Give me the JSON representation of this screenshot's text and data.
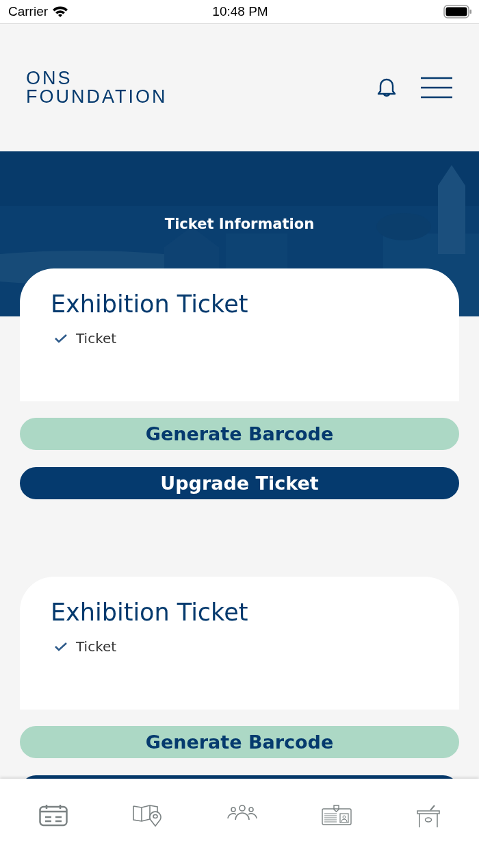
{
  "status_bar": {
    "carrier": "Carrier",
    "time": "10:48 PM"
  },
  "header": {
    "logo_line_1": "ONS",
    "logo_line_2": "FOUNDATION"
  },
  "banner": {
    "title": "Ticket Information"
  },
  "tickets": [
    {
      "title": "Exhibition Ticket",
      "features": [
        "Ticket"
      ],
      "buttons": [
        {
          "kind": "barcode",
          "label": "Generate Barcode"
        },
        {
          "kind": "upgrade",
          "label": "Upgrade Ticket"
        }
      ]
    },
    {
      "title": "Exhibition Ticket",
      "features": [
        "Ticket"
      ],
      "buttons": [
        {
          "kind": "barcode",
          "label": "Generate Barcode"
        },
        {
          "kind": "upgrade"
        }
      ]
    }
  ]
}
